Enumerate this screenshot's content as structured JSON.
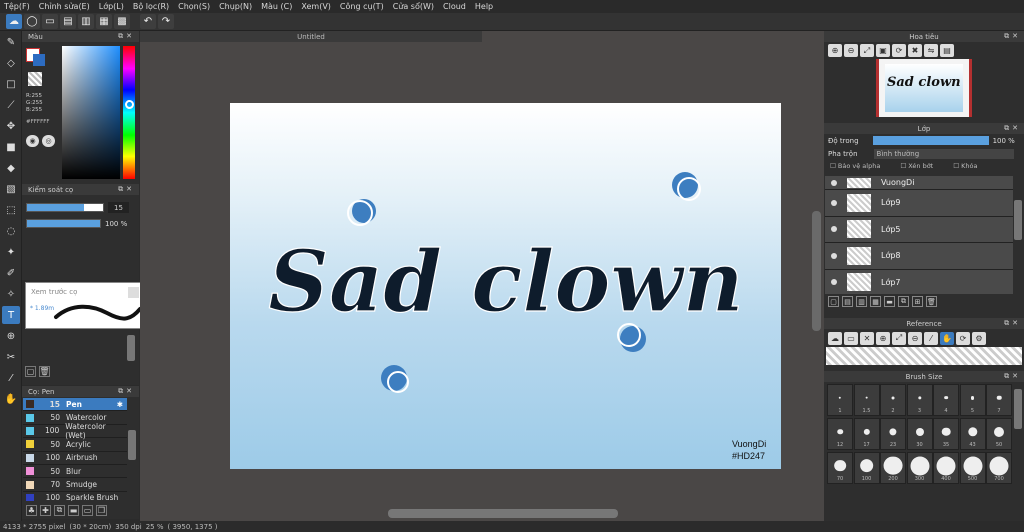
{
  "menu": [
    "Tệp(F)",
    "Chỉnh sửa(E)",
    "Lớp(L)",
    "Bộ lọc(R)",
    "Chọn(S)",
    "Chụp(N)",
    "Màu (C)",
    "Xem(V)",
    "Công cụ(T)",
    "Cửa sổ(W)",
    "Cloud",
    "Help"
  ],
  "color_panel": {
    "title": "Màu",
    "r": "R:255",
    "g": "G:255",
    "b": "B:255",
    "hex": "#FFFFFF",
    "fg_color": "#ffffff",
    "bg_color": "#2d6cc1"
  },
  "brush_control": {
    "title": "Kiểm soát cọ",
    "size_value": "15",
    "size_fraction": 0.75,
    "opacity_value": "100 %",
    "opacity_fraction": 1.0
  },
  "stroke_preview": {
    "title": "Xem trước cọ",
    "size_label": "* 1.89m"
  },
  "brush_list": {
    "title": "Cọ: Pen",
    "items": [
      {
        "num": "15",
        "name": "Pen",
        "color": "#3a2a22",
        "active": true
      },
      {
        "num": "50",
        "name": "Watercolor",
        "color": "#5ac8e8"
      },
      {
        "num": "100",
        "name": "Watercolor (Wet)",
        "color": "#5ac8e8"
      },
      {
        "num": "50",
        "name": "Acrylic",
        "color": "#f0d03a"
      },
      {
        "num": "100",
        "name": "Airbrush",
        "color": "#c8d8e8"
      },
      {
        "num": "50",
        "name": "Blur",
        "color": "#f090d8"
      },
      {
        "num": "70",
        "name": "Smudge",
        "color": "#f0d8b8"
      },
      {
        "num": "100",
        "name": "Sparkle Brush",
        "color": "#3040c0"
      }
    ]
  },
  "canvas": {
    "tab_title": "Untitled",
    "artwork_text": "Sad clown",
    "signature_line1": "VuongDi",
    "signature_line2": "#HD247"
  },
  "navigator": {
    "title": "Hoa tiêu",
    "thumb_text": "Sad clown"
  },
  "layer_panel": {
    "title": "Lớp",
    "opacity_label": "Độ trong",
    "opacity_value": "100 %",
    "blend_label": "Pha trộn",
    "blend_value": "Bình thường",
    "protect_alpha": "Bảo vệ alpha",
    "clipping": "Xén bớt",
    "lock": "Khóa",
    "layers": [
      "VuongDi",
      "Lớp9",
      "Lớp5",
      "Lớp8",
      "Lớp7"
    ]
  },
  "reference": {
    "title": "Reference"
  },
  "brush_size": {
    "title": "Brush Size",
    "sizes": [
      "1",
      "1.5",
      "2",
      "3",
      "4",
      "5",
      "7",
      "12",
      "17",
      "23",
      "30",
      "35",
      "43",
      "50",
      "70",
      "100",
      "200",
      "300",
      "400",
      "500",
      "700"
    ]
  },
  "status": {
    "dimensions": "4133 * 2755 pixel",
    "physical": "(30 * 20cm)",
    "dpi": "350 dpi",
    "zoom": "25 %",
    "coords": "( 3950, 1375 )"
  }
}
